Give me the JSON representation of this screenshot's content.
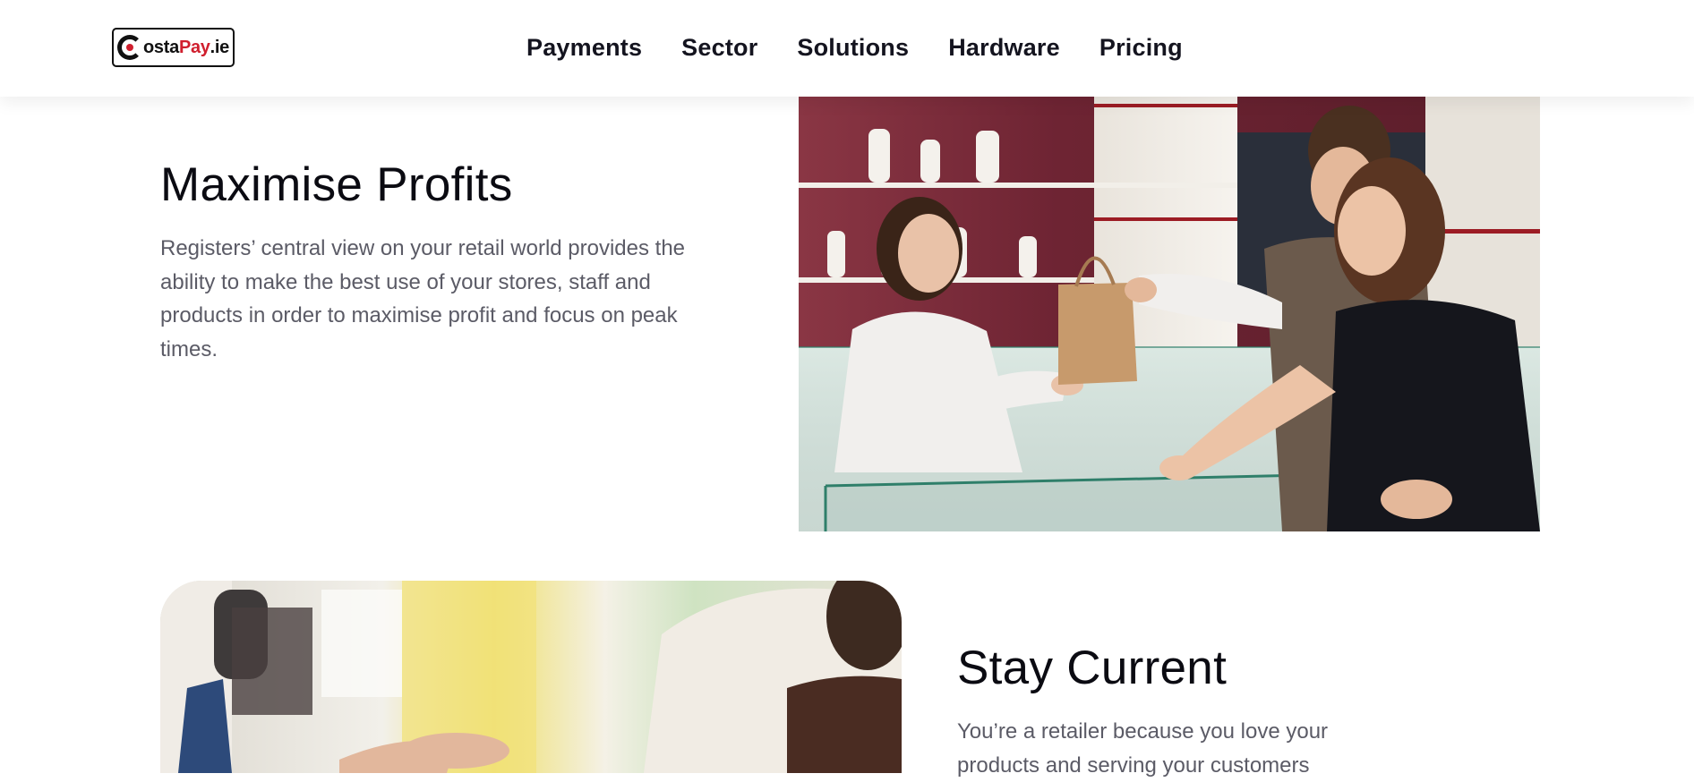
{
  "header": {
    "logo": {
      "part1": "ostaPay",
      "part1_prefix": "C",
      "accent_split": {
        "dark": "osta",
        "red": "Pay",
        "tld": ".ie"
      }
    },
    "nav": [
      {
        "label": "Payments"
      },
      {
        "label": "Sector"
      },
      {
        "label": "Solutions"
      },
      {
        "label": "Hardware"
      },
      {
        "label": "Pricing"
      }
    ]
  },
  "section1": {
    "title": "Maximise Profits",
    "body": "Registers’ central view on your retail world provides the ability to make the best use of your stores, staff and products in order to maximise profit and focus on peak times.",
    "image_alt": "jewelry-shop-photo"
  },
  "section2": {
    "title": "Stay Current",
    "body": "You’re a retailer because you love your products and serving your customers",
    "image_alt": "cafe-counter-photo"
  },
  "colors": {
    "brand_red": "#d01f2e",
    "heading": "#0b0b12",
    "body_text": "#5b5b66",
    "nav_text": "#14141f"
  }
}
